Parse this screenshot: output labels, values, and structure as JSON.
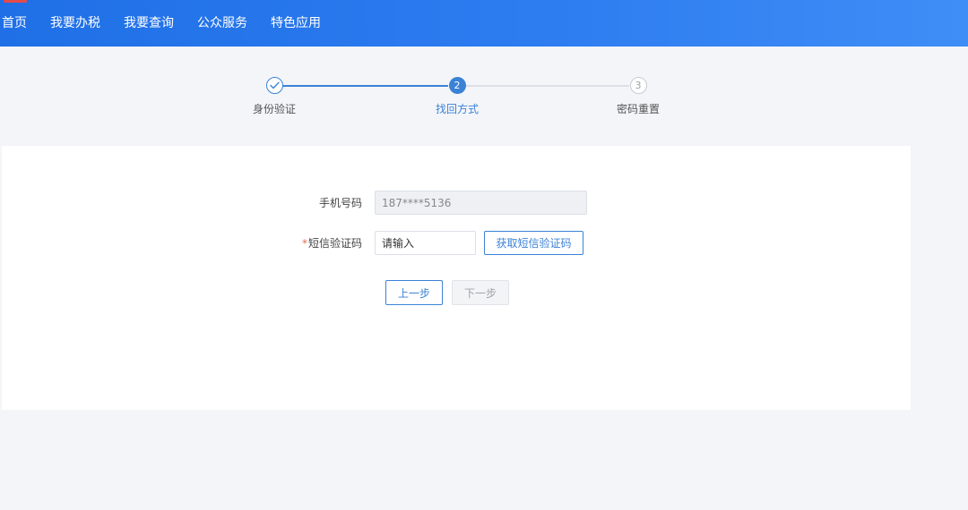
{
  "nav": {
    "items": [
      "首页",
      "我要办税",
      "我要查询",
      "公众服务",
      "特色应用"
    ]
  },
  "steps": [
    {
      "number": "",
      "label": "身份验证",
      "state": "done",
      "icon": "check-icon"
    },
    {
      "number": "2",
      "label": "找回方式",
      "state": "active"
    },
    {
      "number": "3",
      "label": "密码重置",
      "state": "todo"
    }
  ],
  "form": {
    "phone_label": "手机号码",
    "phone_value": "187****5136",
    "sms_required_mark": "*",
    "sms_label": "短信验证码",
    "sms_placeholder": "请输入",
    "get_code_label": "获取短信验证码"
  },
  "actions": {
    "prev_label": "上一步",
    "next_label": "下一步"
  },
  "colors": {
    "accent": "#3b82d6",
    "header_start": "#1f6fe6",
    "header_end": "#3f8df6",
    "required": "#e0734f"
  }
}
